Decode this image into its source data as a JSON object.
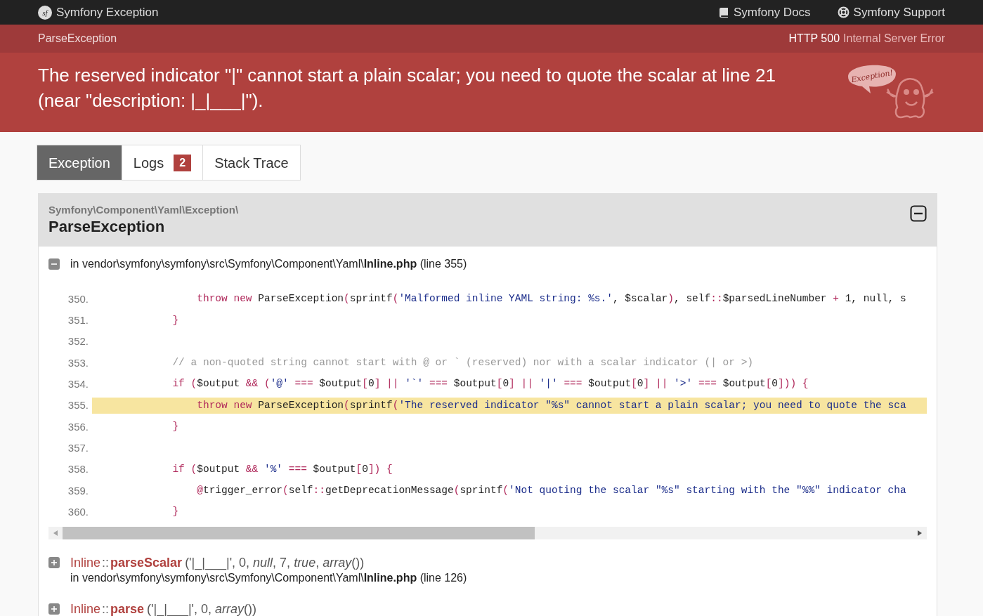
{
  "topbar": {
    "brand_logo": "sf",
    "brand": "Symfony Exception",
    "links": [
      {
        "kind": "docs",
        "label": "Symfony Docs"
      },
      {
        "kind": "support",
        "label": "Symfony Support"
      }
    ]
  },
  "subheader": {
    "exception_class": "ParseException",
    "status_code": "HTTP 500",
    "status_text": "Internal Server Error"
  },
  "message": "The reserved indicator \"|\" cannot start a plain scalar; you need to quote the scalar at line 21 (near \"description: |_|___|\").",
  "mascot": {
    "bubble_text": "Exception!"
  },
  "tabs": [
    {
      "label": "Exception",
      "selected": true
    },
    {
      "label": "Logs",
      "count": "2",
      "selected": false
    },
    {
      "label": "Stack Trace",
      "selected": false
    }
  ],
  "exception": {
    "namespace": "Symfony\\Component\\Yaml\\Exception\\",
    "class": "ParseException",
    "expanded": true
  },
  "trace": [
    {
      "expanded": true,
      "file": "in vendor\\symfony\\symfony\\src\\Symfony\\Component\\Yaml\\**Inline.php** (line 355)",
      "code": [
        {
          "number": "350.",
          "highlighted": false,
          "tokens": [
            {
              "kind": "kw",
              "text": "                throw new "
            },
            {
              "kind": "plain",
              "text": "ParseException"
            },
            {
              "kind": "punct",
              "text": "("
            },
            {
              "kind": "plain",
              "text": "sprintf"
            },
            {
              "kind": "punct",
              "text": "("
            },
            {
              "kind": "str",
              "text": "'Malformed inline YAML string: %s.'"
            },
            {
              "kind": "plain",
              "text": ", $scalar"
            },
            {
              "kind": "punct",
              "text": ")"
            },
            {
              "kind": "plain",
              "text": ", self"
            },
            {
              "kind": "kw",
              "text": "::"
            },
            {
              "kind": "plain",
              "text": "$parsedLineNumber "
            },
            {
              "kind": "kw",
              "text": "+"
            },
            {
              "kind": "plain",
              "text": " 1, null, s"
            }
          ]
        },
        {
          "number": "351.",
          "highlighted": false,
          "tokens": [
            {
              "kind": "punct",
              "text": "            }"
            }
          ]
        },
        {
          "number": "352.",
          "highlighted": false
        },
        {
          "number": "353.",
          "highlighted": false,
          "tokens": [
            {
              "kind": "comment",
              "text": "            // a non-quoted string cannot start with @ or ` (reserved) nor with a scalar indicator (| or >)"
            }
          ]
        },
        {
          "number": "354.",
          "highlighted": false,
          "tokens": [
            {
              "kind": "kw",
              "text": "            if "
            },
            {
              "kind": "punct",
              "text": "("
            },
            {
              "kind": "plain",
              "text": "$output "
            },
            {
              "kind": "kw",
              "text": "&& "
            },
            {
              "kind": "punct",
              "text": "("
            },
            {
              "kind": "str",
              "text": "'@' "
            },
            {
              "kind": "kw",
              "text": "=== "
            },
            {
              "kind": "plain",
              "text": "$output"
            },
            {
              "kind": "punct",
              "text": "["
            },
            {
              "kind": "plain",
              "text": "0"
            },
            {
              "kind": "punct",
              "text": "] || "
            },
            {
              "kind": "str",
              "text": "'`' "
            },
            {
              "kind": "kw",
              "text": "=== "
            },
            {
              "kind": "plain",
              "text": "$output"
            },
            {
              "kind": "punct",
              "text": "["
            },
            {
              "kind": "plain",
              "text": "0"
            },
            {
              "kind": "punct",
              "text": "] || "
            },
            {
              "kind": "str",
              "text": "'|' "
            },
            {
              "kind": "kw",
              "text": "=== "
            },
            {
              "kind": "plain",
              "text": "$output"
            },
            {
              "kind": "punct",
              "text": "["
            },
            {
              "kind": "plain",
              "text": "0"
            },
            {
              "kind": "punct",
              "text": "] || "
            },
            {
              "kind": "str",
              "text": "'>' "
            },
            {
              "kind": "kw",
              "text": "=== "
            },
            {
              "kind": "plain",
              "text": "$output"
            },
            {
              "kind": "punct",
              "text": "["
            },
            {
              "kind": "plain",
              "text": "0"
            },
            {
              "kind": "punct",
              "text": "])) {"
            }
          ]
        },
        {
          "number": "355.",
          "highlighted": true,
          "tokens": [
            {
              "kind": "kw",
              "text": "                throw new "
            },
            {
              "kind": "plain",
              "text": "ParseException"
            },
            {
              "kind": "punct",
              "text": "("
            },
            {
              "kind": "plain",
              "text": "sprintf"
            },
            {
              "kind": "punct",
              "text": "("
            },
            {
              "kind": "str",
              "text": "'The reserved indicator \"%s\" cannot start a plain scalar; you need to quote the sca"
            }
          ]
        },
        {
          "number": "356.",
          "highlighted": false,
          "tokens": [
            {
              "kind": "punct",
              "text": "            }"
            }
          ]
        },
        {
          "number": "357.",
          "highlighted": false
        },
        {
          "number": "358.",
          "highlighted": false,
          "tokens": [
            {
              "kind": "kw",
              "text": "            if "
            },
            {
              "kind": "punct",
              "text": "("
            },
            {
              "kind": "plain",
              "text": "$output "
            },
            {
              "kind": "kw",
              "text": "&& "
            },
            {
              "kind": "str",
              "text": "'%' "
            },
            {
              "kind": "kw",
              "text": "=== "
            },
            {
              "kind": "plain",
              "text": "$output"
            },
            {
              "kind": "punct",
              "text": "["
            },
            {
              "kind": "plain",
              "text": "0"
            },
            {
              "kind": "punct",
              "text": "]) {"
            }
          ]
        },
        {
          "number": "359.",
          "highlighted": false,
          "tokens": [
            {
              "kind": "kw",
              "text": "                @"
            },
            {
              "kind": "plain",
              "text": "trigger_error"
            },
            {
              "kind": "punct",
              "text": "("
            },
            {
              "kind": "plain",
              "text": "self"
            },
            {
              "kind": "kw",
              "text": "::"
            },
            {
              "kind": "plain",
              "text": "getDeprecationMessage"
            },
            {
              "kind": "punct",
              "text": "("
            },
            {
              "kind": "plain",
              "text": "sprintf"
            },
            {
              "kind": "punct",
              "text": "("
            },
            {
              "kind": "str",
              "text": "'Not quoting the scalar \"%s\" starting with the \"%%\" indicator cha"
            }
          ]
        },
        {
          "number": "360.",
          "highlighted": false,
          "tokens": [
            {
              "kind": "punct",
              "text": "            }"
            }
          ]
        }
      ]
    },
    {
      "expanded": false,
      "class": "Inline",
      "separator": "::",
      "method": "parseScalar",
      "args": "('|_|___|', 0, *null*, 7, *true*, *array*())",
      "file": "in vendor\\symfony\\symfony\\src\\Symfony\\Component\\Yaml\\**Inline.php** (line 126)"
    },
    {
      "expanded": false,
      "class": "Inline",
      "separator": "::",
      "method": "parse",
      "args": "('|_|___|', 0, *array*())"
    }
  ]
}
